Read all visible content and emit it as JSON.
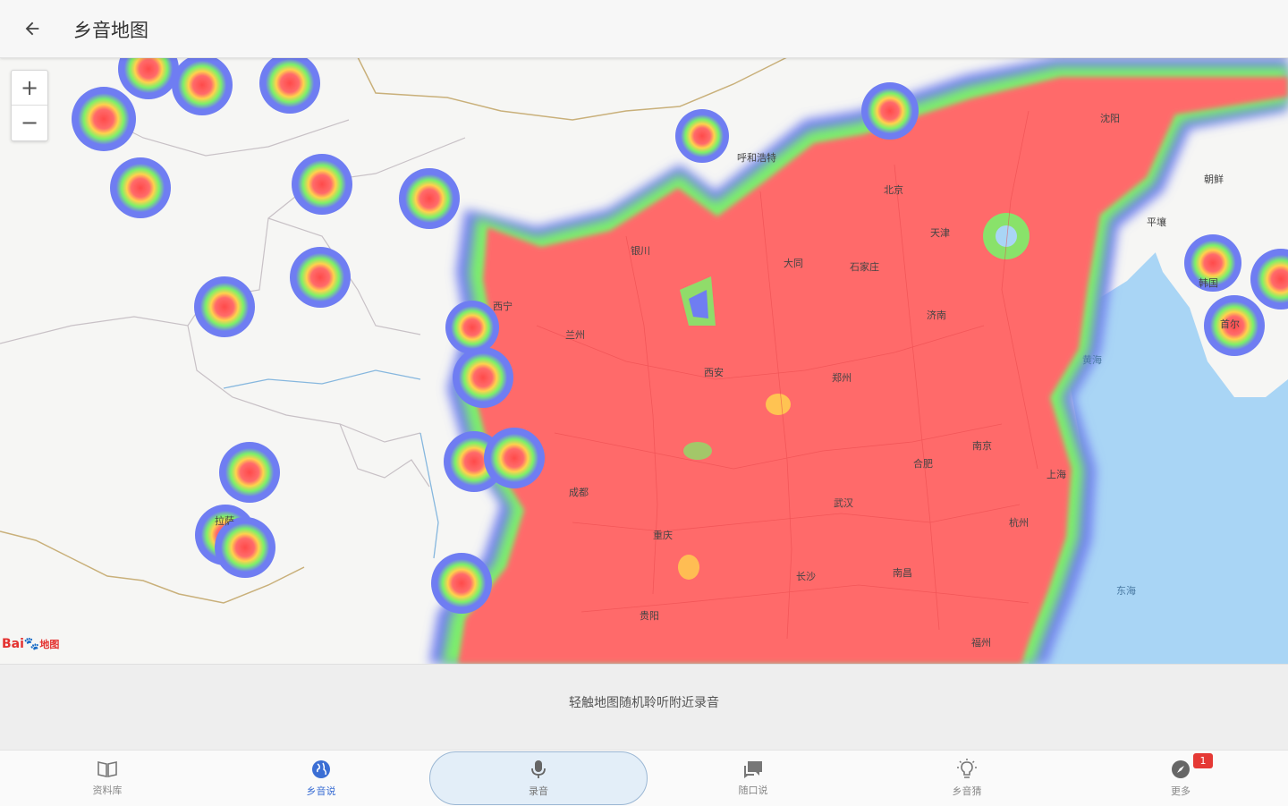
{
  "app": {
    "title": "乡音地图",
    "back_icon": "arrow-left-icon"
  },
  "map": {
    "zoom_in": "+",
    "zoom_out": "−",
    "attribution_logo": "Baidu地图",
    "cities": [
      {
        "name": "北京"
      },
      {
        "name": "天津"
      },
      {
        "name": "大同"
      },
      {
        "name": "石家庄"
      },
      {
        "name": "呼和浩特"
      },
      {
        "name": "银川"
      },
      {
        "name": "西宁"
      },
      {
        "name": "兰州"
      },
      {
        "name": "西安"
      },
      {
        "name": "郑州"
      },
      {
        "name": "济南"
      },
      {
        "name": "沈阳"
      },
      {
        "name": "南京"
      },
      {
        "name": "合肥"
      },
      {
        "name": "上海"
      },
      {
        "name": "武汉"
      },
      {
        "name": "杭州"
      },
      {
        "name": "成都"
      },
      {
        "name": "重庆"
      },
      {
        "name": "长沙"
      },
      {
        "name": "南昌"
      },
      {
        "name": "贵阳"
      },
      {
        "name": "福州"
      },
      {
        "name": "朝鲜"
      },
      {
        "name": "首尔"
      },
      {
        "name": "平壤"
      },
      {
        "name": "韩国"
      },
      {
        "name": "拉萨"
      }
    ],
    "seas": [
      {
        "name": "黄海"
      },
      {
        "name": "东海"
      }
    ],
    "legend_colors": {
      "hot": "#ff6b6b",
      "warm": "#ffd24d",
      "mid": "#7cf06a",
      "cool": "#6f7df2",
      "sea": "#a9d5f5"
    }
  },
  "hint": {
    "text": "轻触地图随机聆听附近录音"
  },
  "nav": {
    "items": [
      {
        "label": "资料库",
        "icon": "book-icon"
      },
      {
        "label": "乡音说",
        "icon": "globe-icon"
      },
      {
        "label": "录音",
        "icon": "microphone-icon"
      },
      {
        "label": "随口说",
        "icon": "chat-icon"
      },
      {
        "label": "乡音猜",
        "icon": "lightbulb-icon"
      },
      {
        "label": "更多",
        "icon": "compass-icon"
      }
    ],
    "badge": "1"
  }
}
